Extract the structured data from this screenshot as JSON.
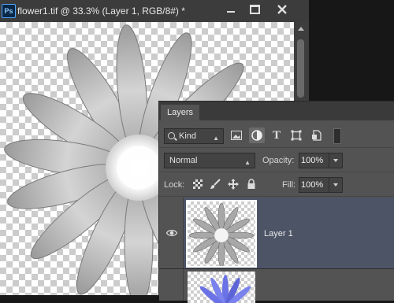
{
  "document": {
    "app_icon_label": "Ps",
    "title": "flower1.tif @ 33.3% (Layer 1, RGB/8#) *"
  },
  "layers_panel": {
    "tab_label": "Layers",
    "filter": {
      "kind_label": "Kind"
    },
    "blend": {
      "mode": "Normal",
      "opacity_label": "Opacity:",
      "opacity_value": "100%"
    },
    "lock": {
      "lock_label": "Lock:",
      "fill_label": "Fill:",
      "fill_value": "100%"
    },
    "layers": [
      {
        "name": "Layer 1",
        "visible": true,
        "selected": true
      },
      {
        "name": "",
        "visible": false,
        "selected": false
      }
    ]
  },
  "colors": {
    "selected_layer": "#4c5466",
    "panel_bg": "#535353",
    "flower_petal_second_layer": "#6a72e6"
  }
}
